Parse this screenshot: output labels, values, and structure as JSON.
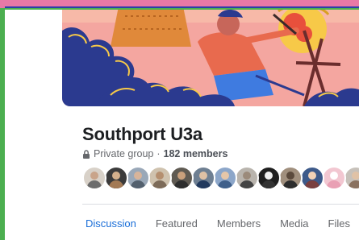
{
  "group": {
    "name": "Southport U3a",
    "privacy_label": "Private group",
    "separator": "·",
    "member_count": "182 members"
  },
  "avatars": [
    {
      "name": "member-1",
      "bg": "#d8d1c8",
      "head": "#c9a48a",
      "body": "#6c6c6c"
    },
    {
      "name": "member-2",
      "bg": "#3b3b3b",
      "head": "#d4b08c",
      "body": "#a37a55"
    },
    {
      "name": "member-3",
      "bg": "#9aa8b8",
      "head": "#d8b49a",
      "body": "#53606e"
    },
    {
      "name": "member-4",
      "bg": "#cfc2ae",
      "head": "#b58f6f",
      "body": "#7d6b59"
    },
    {
      "name": "member-5",
      "bg": "#5f5a52",
      "head": "#c9a07c",
      "body": "#2e2e2e"
    },
    {
      "name": "member-6",
      "bg": "#6e7f92",
      "head": "#dfc1a5",
      "body": "#223a5e"
    },
    {
      "name": "member-7",
      "bg": "#8ca6c9",
      "head": "#e6c6a8",
      "body": "#3f5f8a"
    },
    {
      "name": "member-8",
      "bg": "#b9b4ad",
      "head": "#9b8a7a",
      "body": "#444444"
    },
    {
      "name": "member-9",
      "bg": "#1f1f1f",
      "head": "#f0f0f0",
      "body": "#333333"
    },
    {
      "name": "member-10",
      "bg": "#a08f7d",
      "head": "#5b4a3c",
      "body": "#2d2d2d"
    },
    {
      "name": "member-11",
      "bg": "#3d5a8a",
      "head": "#f2d2b6",
      "body": "#7a3f3f"
    },
    {
      "name": "member-12",
      "bg": "#f2c7d1",
      "head": "#ffffff",
      "body": "#e9a0b4"
    },
    {
      "name": "member-13",
      "bg": "#c7c1ba",
      "head": "#e0c2a6",
      "body": "#8a7260"
    },
    {
      "name": "member-14",
      "bg": "#ececec",
      "head": "#ffffff",
      "body": "#cfcfcf"
    },
    {
      "name": "member-15",
      "bg": "#d8dadf",
      "head": "#b0b3b8",
      "body": "#b0b3b8"
    }
  ],
  "tabs": [
    {
      "label": "Discussion",
      "active": true
    },
    {
      "label": "Featured",
      "active": false
    },
    {
      "label": "Members",
      "active": false
    },
    {
      "label": "Media",
      "active": false
    },
    {
      "label": "Files",
      "active": false
    }
  ],
  "colors": {
    "accent": "#1877f2",
    "title": "#1c1e21",
    "muted": "#65676b",
    "cover_navy": "#2b3a8f",
    "cover_pink": "#f4a6a0",
    "cover_yellow": "#f7c948"
  }
}
